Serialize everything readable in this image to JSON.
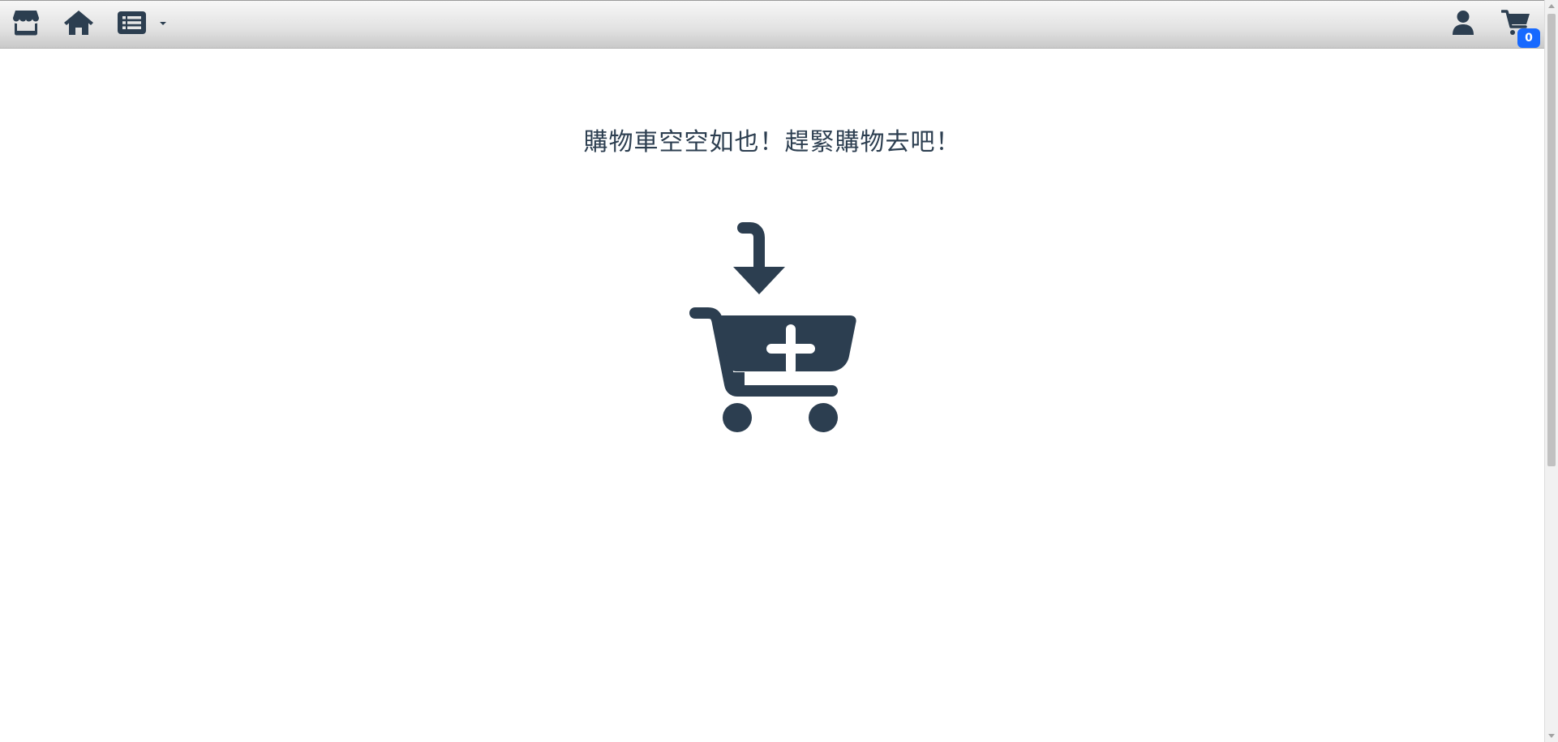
{
  "navbar": {
    "left_icons": [
      "store-icon",
      "home-icon",
      "list-icon",
      "caret-down-icon"
    ],
    "right_icons": [
      "user-icon",
      "cart-icon"
    ],
    "cart_count": "0",
    "icon_color": "#2c3e50",
    "badge_color": "#1769ff"
  },
  "main": {
    "empty_message": "購物車空空如也！趕緊購物去吧！",
    "illustration": "cart-add-icon"
  }
}
